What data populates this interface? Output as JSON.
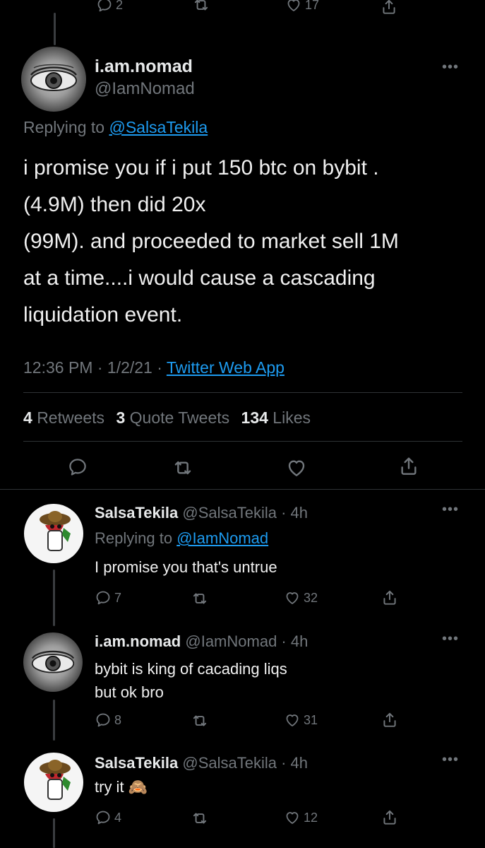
{
  "top_action_bar": {
    "reply_count": "2",
    "like_count": "17"
  },
  "main_tweet": {
    "display_name": "i.am.nomad",
    "handle": "@IamNomad",
    "replying_prefix": "Replying to",
    "replying_to": "@SalsaTekila",
    "text_lines": [
      "i promise you if i put 150 btc on bybit .",
      "(4.9M) then did 20x",
      "(99M). and proceeded to market sell 1M",
      "at a time....i would cause a cascading",
      "liquidation event."
    ],
    "time": "12:36 PM",
    "date": "1/2/21",
    "source": "Twitter Web App",
    "stats": {
      "retweets_num": "4",
      "retweets_label": "Retweets",
      "quotes_num": "3",
      "quotes_label": "Quote Tweets",
      "likes_num": "134",
      "likes_label": "Likes"
    },
    "more_label": "•••"
  },
  "replies": [
    {
      "display_name": "SalsaTekila",
      "handle_time": "@SalsaTekila · 4h",
      "replying_prefix": "Replying to",
      "replying_to": "@IamNomad",
      "text": "I promise you that's untrue",
      "reply_count": "7",
      "like_count": "32",
      "more_label": "•••"
    },
    {
      "display_name": "i.am.nomad",
      "handle_time": "@IamNomad · 4h",
      "text_line1": "bybit is king of cacading liqs",
      "text_line2": "but ok bro",
      "reply_count": "8",
      "like_count": "31",
      "more_label": "•••"
    },
    {
      "display_name": "SalsaTekila",
      "handle_time": "@SalsaTekila · 4h",
      "text": "try it",
      "emoji": "🙈",
      "reply_count": "4",
      "like_count": "12",
      "more_label": "•••"
    }
  ],
  "icons": [
    "reply-icon",
    "retweet-icon",
    "like-icon",
    "share-icon",
    "more-icon",
    "see-no-evil-monkey-emoji"
  ],
  "colors": {
    "background": "#000000",
    "text": "#e7e9ea",
    "secondary": "#71767b",
    "link": "#1d9bf0",
    "divider": "#2f3336"
  }
}
